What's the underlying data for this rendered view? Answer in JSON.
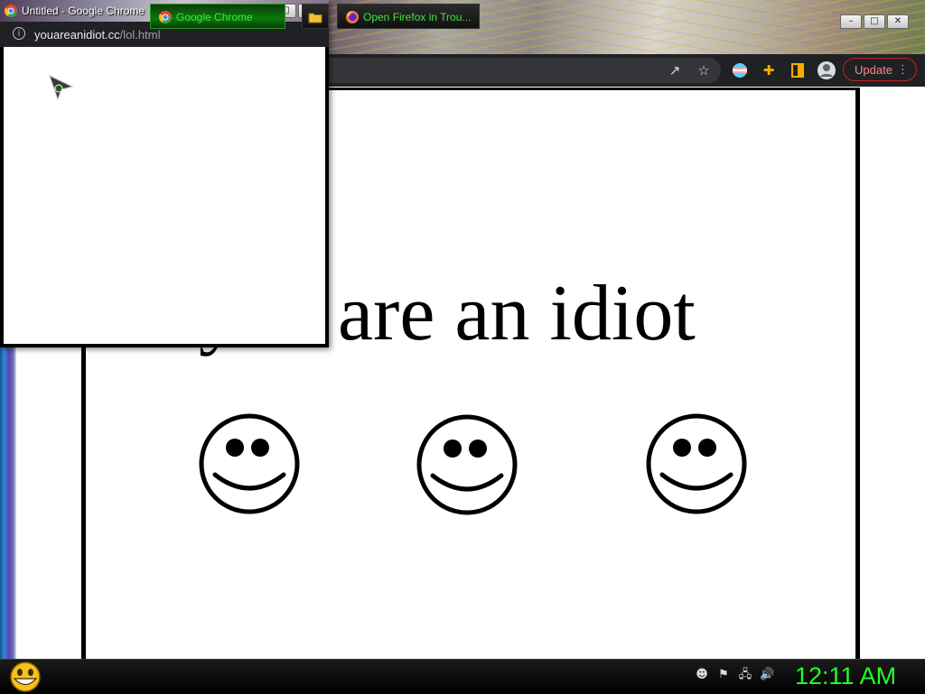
{
  "popup": {
    "title": "Untitled - Google Chrome",
    "url_domain": "youareanidiot.cc",
    "url_path": "/lol.html",
    "buttons": {
      "minimize": "–",
      "maximize": "□",
      "close": "✕"
    }
  },
  "browser": {
    "update_label": "Update",
    "menu_dots": "⋮",
    "buttons": {
      "minimize": "–",
      "maximize": "□",
      "close": "✕"
    }
  },
  "page": {
    "headline": "you are an idiot",
    "smiley_count": 3
  },
  "taskbar": {
    "tasks": [
      {
        "label": "Google Chrome",
        "icon": "chrome-icon",
        "active": true
      },
      {
        "label": "",
        "icon": "folder-icon",
        "active": false
      },
      {
        "label": "Open Firefox in Trou...",
        "icon": "firefox-icon",
        "active": false
      }
    ],
    "clock": "12:11 AM"
  },
  "colors": {
    "taskbar_text": "#3ee83e",
    "clock": "#22ff22",
    "update_accent": "#f28b82"
  }
}
